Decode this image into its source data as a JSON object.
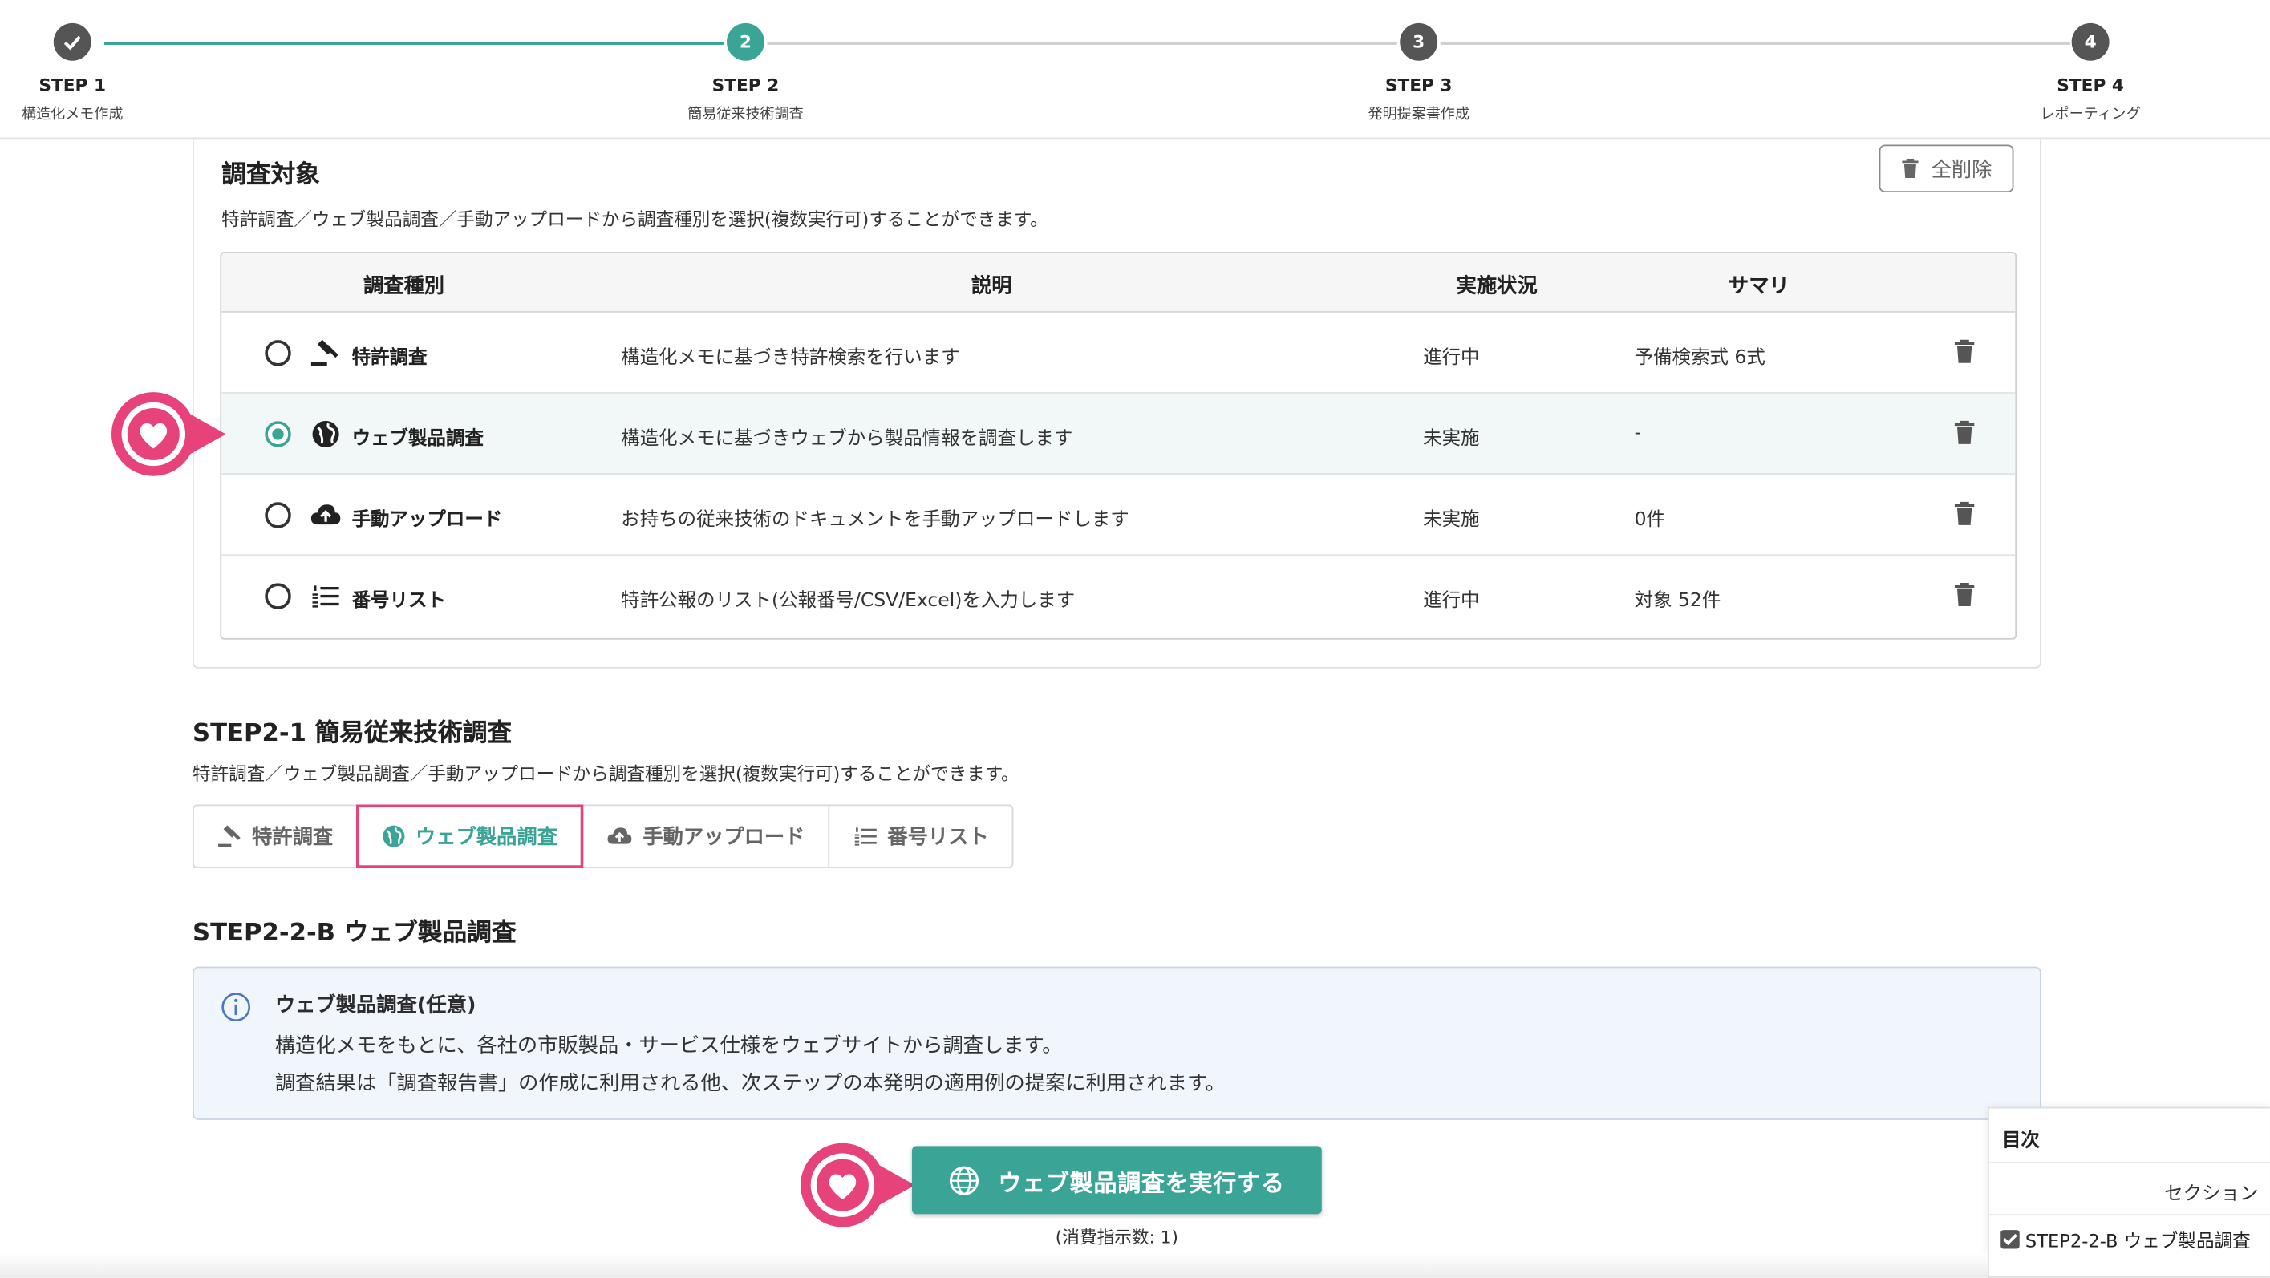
{
  "stepper": {
    "steps": [
      {
        "label": "STEP 1",
        "sub": "構造化メモ作成",
        "marker": ""
      },
      {
        "label": "STEP 2",
        "sub": "簡易従来技術調査",
        "marker": "2"
      },
      {
        "label": "STEP 3",
        "sub": "発明提案書作成",
        "marker": "3"
      },
      {
        "label": "STEP 4",
        "sub": "レポーティング",
        "marker": "4"
      }
    ]
  },
  "target": {
    "title": "調査対象",
    "description": "特許調査／ウェブ製品調査／手動アップロードから調査種別を選択(複数実行可)することができます。",
    "delete_all_label": "全削除",
    "columns": [
      "調査種別",
      "説明",
      "実施状況",
      "サマリ"
    ],
    "rows": [
      {
        "name": "特許調査",
        "icon": "gavel-icon",
        "desc": "構造化メモに基づき特許検索を行います",
        "status": "進行中",
        "summary": "予備検索式 6式",
        "selected": false
      },
      {
        "name": "ウェブ製品調査",
        "icon": "globe-icon",
        "desc": "構造化メモに基づきウェブから製品情報を調査します",
        "status": "未実施",
        "summary": "-",
        "selected": true
      },
      {
        "name": "手動アップロード",
        "icon": "cloud-upload-icon",
        "desc": "お持ちの従来技術のドキュメントを手動アップロードします",
        "status": "未実施",
        "summary": "0件",
        "selected": false
      },
      {
        "name": "番号リスト",
        "icon": "numbered-list-icon",
        "desc": "特許公報のリスト(公報番号/CSV/Excel)を入力します",
        "status": "進行中",
        "summary": "対象 52件",
        "selected": false
      }
    ]
  },
  "step21": {
    "title": "STEP2-1 簡易従来技術調査",
    "description": "特許調査／ウェブ製品調査／手動アップロードから調査種別を選択(複数実行可)することができます。",
    "tabs": [
      "特許調査",
      "ウェブ製品調査",
      "手動アップロード",
      "番号リスト"
    ],
    "active_tab": "ウェブ製品調査"
  },
  "step22": {
    "title": "STEP2-2-B ウェブ製品調査",
    "info_title": "ウェブ製品調査(任意)",
    "info_line1": "構造化メモをもとに、各社の市販製品・サービス仕様をウェブサイトから調査します。",
    "info_line2": "調査結果は「調査報告書」の作成に利用される他、次ステップの本発明の適用例の提案に利用されます。",
    "run_button": "ウェブ製品調査を実行する",
    "run_sub": "(消費指示数: 1)"
  },
  "toc": {
    "title": "目次",
    "section_label": "セクション",
    "item": "STEP2-2-B ウェブ製品調査"
  },
  "colors": {
    "accent": "#3aa596",
    "highlight": "#e8427a"
  }
}
